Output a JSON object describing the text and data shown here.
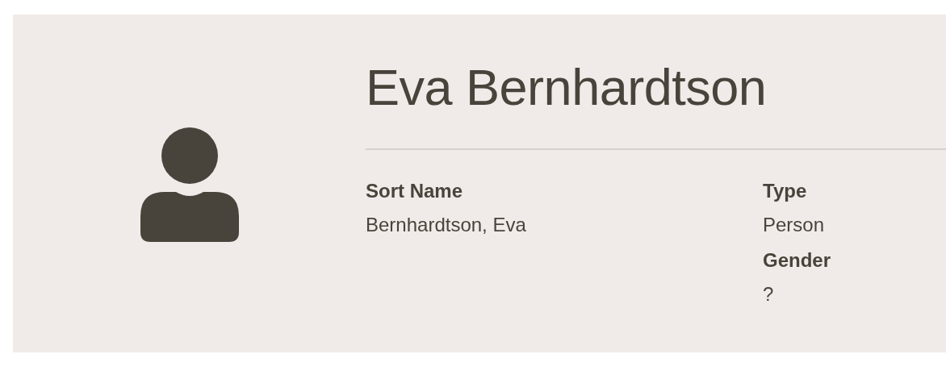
{
  "name": "Eva Bernhardtson",
  "columns": [
    [
      {
        "label": "Sort Name",
        "value": "Bernhardtson, Eva"
      }
    ],
    [
      {
        "label": "Type",
        "value": "Person"
      },
      {
        "label": "Gender",
        "value": "?"
      }
    ]
  ]
}
